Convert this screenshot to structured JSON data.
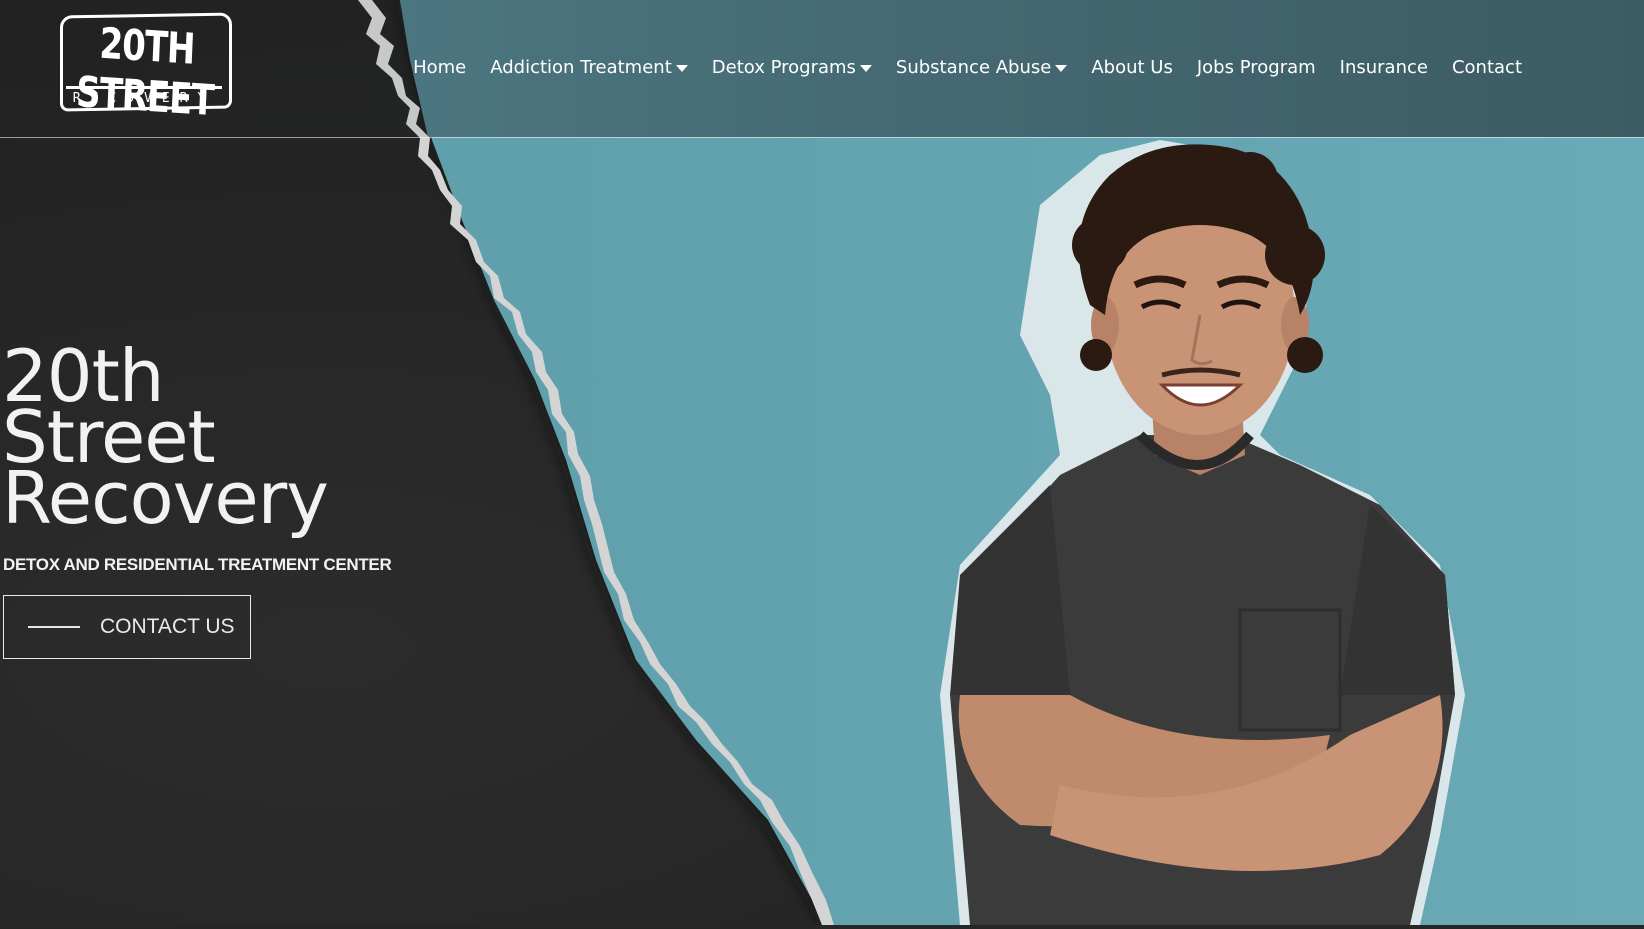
{
  "brand": {
    "logo_top": "20TH STREET",
    "logo_bottom": "RECOVERY"
  },
  "nav": {
    "items": [
      {
        "label": "Home",
        "has_dropdown": false
      },
      {
        "label": "Addiction Treatment",
        "has_dropdown": true
      },
      {
        "label": "Detox Programs",
        "has_dropdown": true
      },
      {
        "label": "Substance Abuse",
        "has_dropdown": true
      },
      {
        "label": "About Us",
        "has_dropdown": false
      },
      {
        "label": "Jobs Program",
        "has_dropdown": false
      },
      {
        "label": "Insurance",
        "has_dropdown": false
      },
      {
        "label": "Contact",
        "has_dropdown": false
      }
    ]
  },
  "hero": {
    "title_line1": "20th",
    "title_line2": "Street",
    "title_line3": "Recovery",
    "subtitle": "DETOX AND RESIDENTIAL TREATMENT CENTER",
    "cta_label": "CONTACT US",
    "image_icon": "smiling-man-photo"
  },
  "colors": {
    "dark_bg": "#232323",
    "teal_bg": "#67a9b5",
    "header_teal": "#4c7480",
    "text": "#ffffff",
    "shirt": "#3a3a3a",
    "skin": "#c99476",
    "hair": "#2a1a12"
  }
}
